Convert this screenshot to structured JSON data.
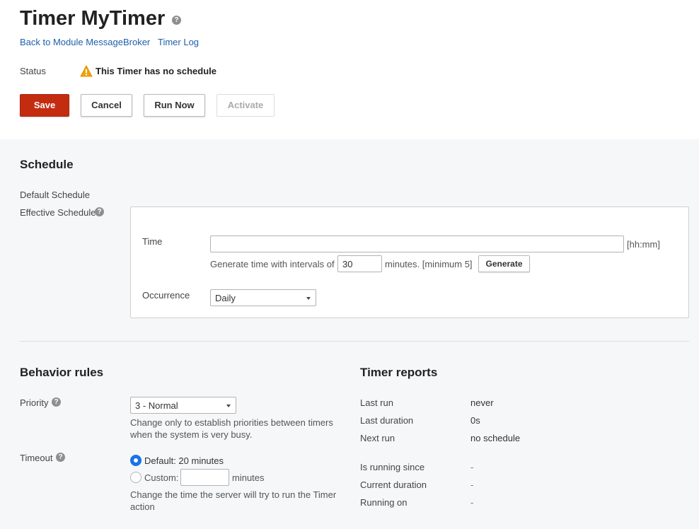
{
  "header": {
    "title": "Timer MyTimer",
    "help_icon": "question-icon",
    "links": {
      "back": "Back to Module MessageBroker",
      "log": "Timer Log"
    },
    "status_label": "Status",
    "status_icon": "warning-icon",
    "status_text": "This Timer has no schedule"
  },
  "toolbar": {
    "save": "Save",
    "cancel": "Cancel",
    "run_now": "Run Now",
    "activate": "Activate"
  },
  "schedule": {
    "heading": "Schedule",
    "default_schedule_label": "Default Schedule",
    "effective_schedule_label": "Effective Schedule",
    "time_label": "Time",
    "time_value": "",
    "time_format": "[hh:mm]",
    "generate_prefix": "Generate time with intervals of",
    "interval_value": "30",
    "generate_suffix": "minutes. [minimum 5]",
    "generate_button": "Generate",
    "occurrence_label": "Occurrence",
    "occurrence_value": "Daily"
  },
  "behavior": {
    "heading": "Behavior rules",
    "priority_label": "Priority",
    "priority_value": "3 - Normal",
    "priority_hint_1": "Change only to establish priorities between timers",
    "priority_hint_2": "when the system is very busy.",
    "timeout_label": "Timeout",
    "timeout_default": "Default: 20 minutes",
    "timeout_custom": "Custom:",
    "timeout_custom_value": "",
    "timeout_unit": "minutes",
    "timeout_hint_1": "Change the time the server will try to run the Timer",
    "timeout_hint_2": "action"
  },
  "reports": {
    "heading": "Timer reports",
    "rows": [
      {
        "label": "Last run",
        "value": "never"
      },
      {
        "label": "Last duration",
        "value": "0s"
      },
      {
        "label": "Next run",
        "value": "no schedule"
      },
      {
        "label": "Is running since",
        "value": "-"
      },
      {
        "label": "Current duration",
        "value": "-"
      },
      {
        "label": "Running on",
        "value": "-"
      }
    ]
  },
  "colors": {
    "primary": "#c42c10",
    "link": "#1f5faa",
    "warning": "#f0a30a",
    "radio_selected": "#1a73e8"
  }
}
